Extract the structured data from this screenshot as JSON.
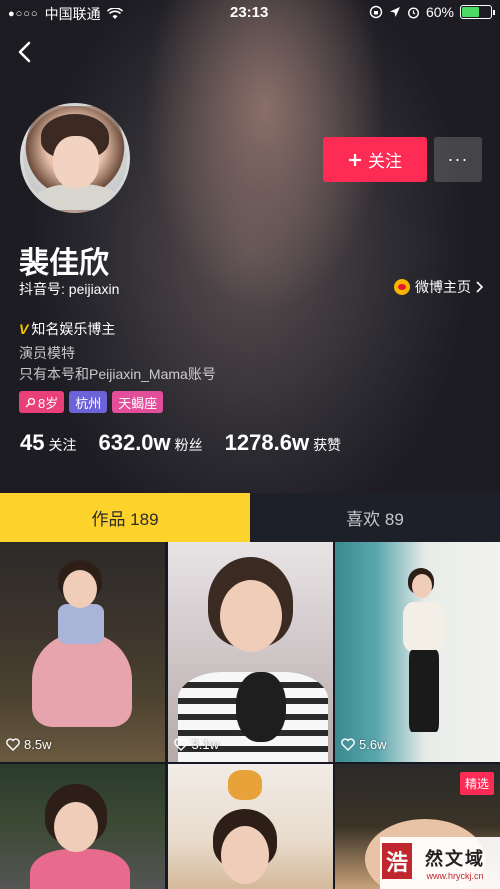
{
  "status_bar": {
    "carrier": "中国联通",
    "signal_dots": "●○○○",
    "time": "23:13",
    "battery": "60%",
    "battery_level": 0.6
  },
  "profile": {
    "name": "裴佳欣",
    "douyin_id_label": "抖音号: peijiaxin",
    "weibo_link": "微博主页",
    "follow_button": "关注",
    "more_button": "···",
    "verified_text": "知名娱乐博主",
    "bio_line1": "演员模特",
    "bio_line2": "只有本号和Peijiaxin_Mama账号",
    "tags": {
      "age": "8岁",
      "city": "杭州",
      "zodiac": "天蝎座"
    },
    "stats": {
      "following_count": "45",
      "following_label": "关注",
      "followers_count": "632.0w",
      "followers_label": "粉丝",
      "likes_count": "1278.6w",
      "likes_label": "获赞"
    }
  },
  "tabs": {
    "works": "作品 189",
    "likes": "喜欢 89"
  },
  "videos": [
    {
      "likes": "8.5w"
    },
    {
      "likes": "3.1w"
    },
    {
      "likes": "5.6w"
    },
    {
      "likes": ""
    },
    {
      "likes": ""
    },
    {
      "likes": "",
      "featured": "精选"
    }
  ],
  "watermark": {
    "badge": "浩",
    "main": "然文域",
    "url": "www.hryckj.cn"
  },
  "colors": {
    "accent_red": "#fe2c55",
    "tab_yellow": "#fdd22a",
    "verified_gold": "#f7c500"
  }
}
